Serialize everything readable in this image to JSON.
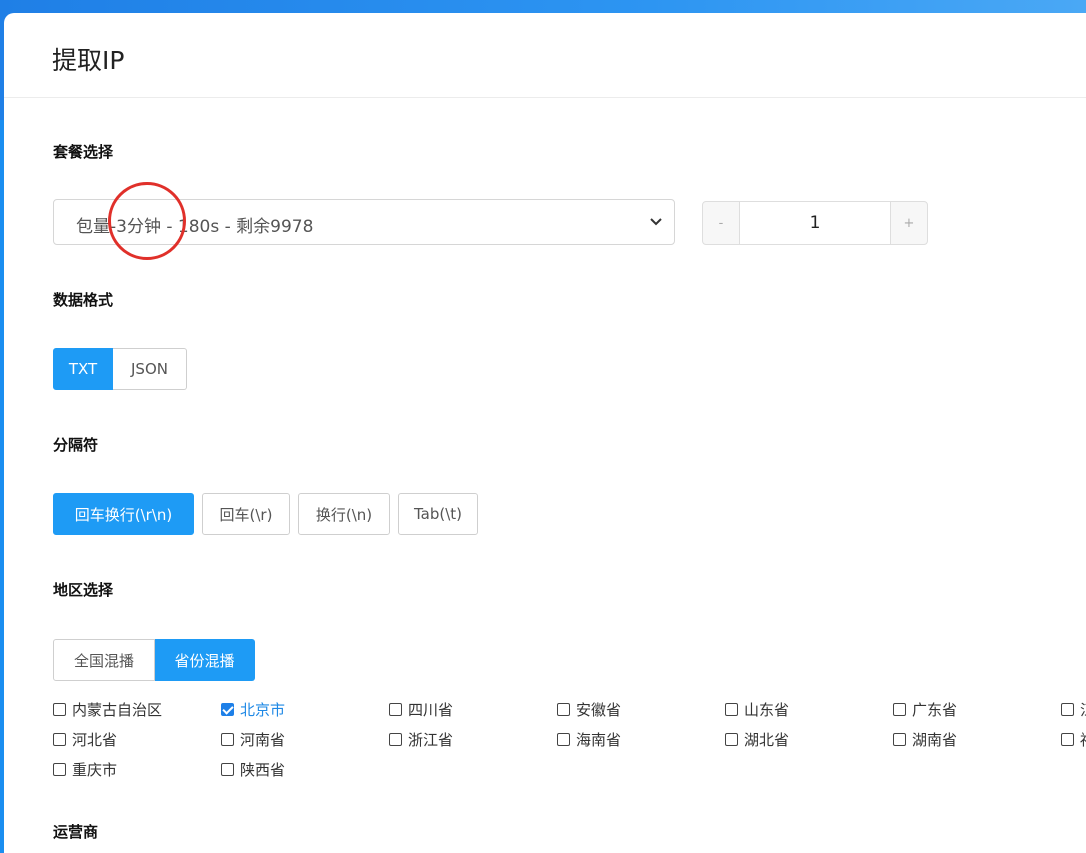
{
  "dialog": {
    "title": "提取IP"
  },
  "package": {
    "label": "套餐选择",
    "selected": "包量-3分钟 - 180s - 剩余9978",
    "quantity": {
      "minus": "-",
      "value": "1",
      "plus": "+"
    }
  },
  "format": {
    "label": "数据格式",
    "options": [
      "TXT",
      "JSON"
    ],
    "active": "TXT"
  },
  "separator": {
    "label": "分隔符",
    "options": [
      "回车换行(\\r\\n)",
      "回车(\\r)",
      "换行(\\n)",
      "Tab(\\t)"
    ],
    "active": "回车换行(\\r\\n)"
  },
  "region": {
    "label": "地区选择",
    "modes": [
      "全国混播",
      "省份混播"
    ],
    "active_mode": "省份混播",
    "provinces": [
      {
        "name": "内蒙古自治区",
        "checked": false
      },
      {
        "name": "北京市",
        "checked": true
      },
      {
        "name": "四川省",
        "checked": false
      },
      {
        "name": "安徽省",
        "checked": false
      },
      {
        "name": "山东省",
        "checked": false
      },
      {
        "name": "广东省",
        "checked": false
      },
      {
        "name": "江",
        "checked": false
      },
      {
        "name": "河北省",
        "checked": false
      },
      {
        "name": "河南省",
        "checked": false
      },
      {
        "name": "浙江省",
        "checked": false
      },
      {
        "name": "海南省",
        "checked": false
      },
      {
        "name": "湖北省",
        "checked": false
      },
      {
        "name": "湖南省",
        "checked": false
      },
      {
        "name": "福",
        "checked": false
      },
      {
        "name": "重庆市",
        "checked": false
      },
      {
        "name": "陕西省",
        "checked": false
      }
    ]
  },
  "carrier": {
    "label": "运营商"
  },
  "colors": {
    "accent": "#1e9bf5",
    "annotation": "#e0302a"
  }
}
